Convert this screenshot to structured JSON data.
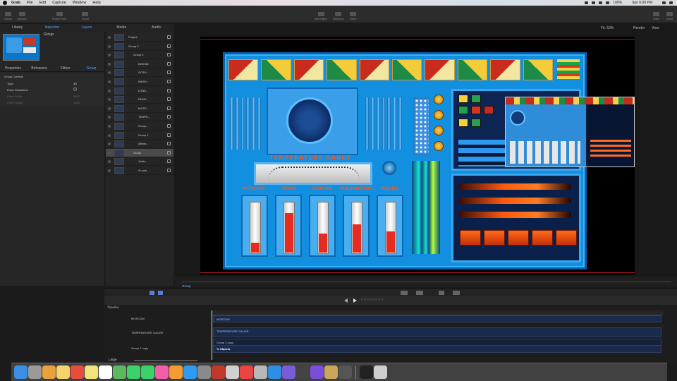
{
  "menubar": {
    "items": [
      "Grab",
      "File",
      "Edit",
      "Capture",
      "Window",
      "Help"
    ],
    "clock": "Sun 6:00 PM",
    "percent": "100%"
  },
  "toolbar": {
    "left": [
      "Library",
      "Inspector",
      "Project Pane",
      "Import"
    ],
    "center": [
      "New Object",
      "Behaviors",
      "Filters"
    ],
    "right": [
      "Share",
      "Export"
    ]
  },
  "panels": {
    "tabs": [
      "Library",
      "Inspector",
      "Layers",
      "Media",
      "Audio"
    ],
    "active": [
      "Inspector",
      "Layers"
    ]
  },
  "inspector": {
    "selected_name": "Group",
    "tabs": [
      "Properties",
      "Behaviors",
      "Filters",
      "Group"
    ],
    "section_title": "Group Controls",
    "rows": [
      {
        "label": "Type",
        "value": "3D"
      },
      {
        "label": "Fixed Resolution",
        "value": ""
      },
      {
        "label": "Fixed Width",
        "value": "3840"
      },
      {
        "label": "Fixed Height",
        "value": "2160"
      }
    ]
  },
  "layers": [
    {
      "name": "Project",
      "indent": 0
    },
    {
      "name": "Group 3",
      "indent": 0
    },
    {
      "name": "Group 2",
      "indent": 1
    },
    {
      "name": "Defense",
      "indent": 2
    },
    {
      "name": "GOTH...",
      "indent": 2
    },
    {
      "name": "WASH...",
      "indent": 2
    },
    {
      "name": "LOND...",
      "indent": 2
    },
    {
      "name": "PARIS",
      "indent": 2
    },
    {
      "name": "MOSC...",
      "indent": 2
    },
    {
      "name": "TEMPE...",
      "indent": 2
    },
    {
      "name": "Group...",
      "indent": 2
    },
    {
      "name": "Group 1",
      "indent": 2
    },
    {
      "name": "Altime...",
      "indent": 2
    },
    {
      "name": "Group",
      "indent": 1,
      "selected": true
    },
    {
      "name": "Justic...",
      "indent": 2
    },
    {
      "name": "% com...",
      "indent": 2
    }
  ],
  "canvas": {
    "fit_label": "Fit: 53%",
    "render_label": "Render",
    "view_label": "View"
  },
  "console": {
    "gauge_title": "TEMPERATURE GAUGE",
    "cities": [
      {
        "name": "MOSCOW",
        "level": 0.2
      },
      {
        "name": "PARIS",
        "level": 0.78
      },
      {
        "name": "LONDON",
        "level": 0.38
      },
      {
        "name": "WASHINGTON",
        "level": 0.55
      },
      {
        "name": "BEIJING",
        "level": 0.42
      }
    ]
  },
  "canvas_footer": {
    "group_label": "Group"
  },
  "timeline": {
    "title": "Timeline",
    "layers": [
      "MOSCOW",
      "TEMPERATURE GAUGE",
      "Group 1 copy"
    ],
    "clips": [
      "MOSCOW",
      "TEMPERATURE GAUGE",
      "Group 1 copy",
      "% Objects"
    ],
    "zoom_label": "Large"
  },
  "colors": {
    "accent": "#5aa1ff",
    "console_blue": "#138fe0",
    "label_orange": "#f05a26",
    "mercury_red": "#e62b20"
  },
  "dock": {
    "icons": [
      "finder-icon",
      "launchpad-icon",
      "photos-icon",
      "notes-icon",
      "calendar-icon",
      "stickies-icon",
      "reminders-icon",
      "maps-icon",
      "messages-icon",
      "facetime-icon",
      "itunes-icon",
      "ibooks-icon",
      "app-store-icon",
      "system-preferences-icon",
      "photo-booth-icon",
      "preview-icon",
      "chrome-icon",
      "script-editor-icon",
      "safari-icon",
      "imovie-icon",
      "final-cut-icon",
      "motion-icon",
      "compressor-icon",
      "screenshot-icon",
      "terminal-icon",
      "trash-icon"
    ]
  }
}
